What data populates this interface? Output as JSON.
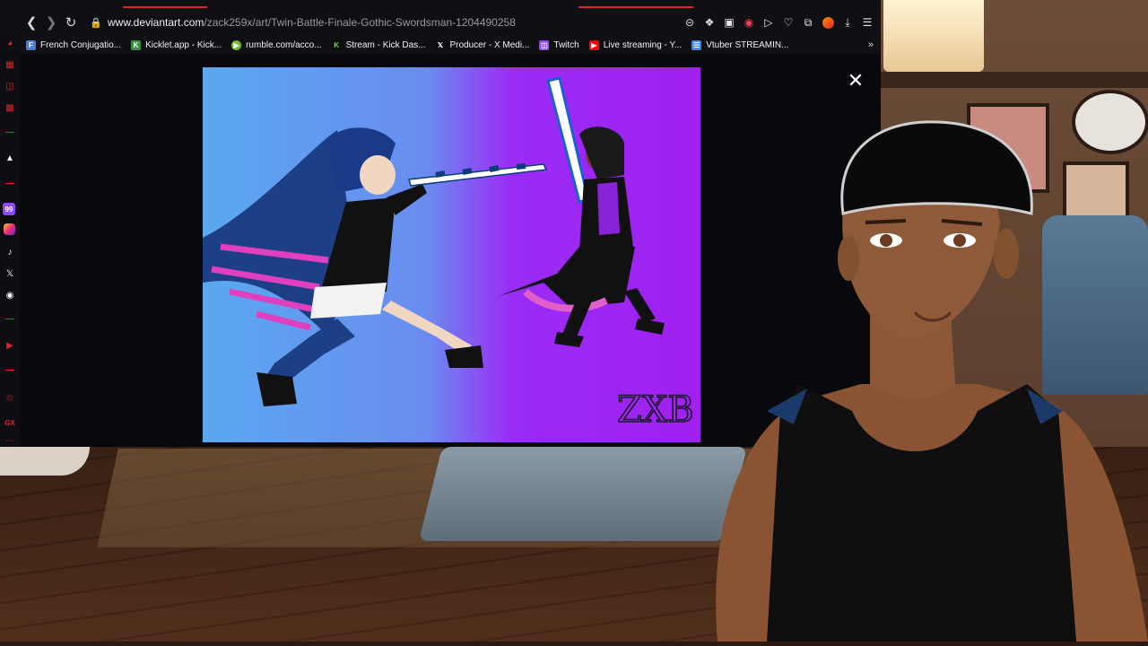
{
  "browser": {
    "url_host": "www.deviantart.com",
    "url_path": "/zack259x/art/Twin-Battle-Finale-Gothic-Swordsman-1204490258",
    "toolbar_icons": [
      "zoom-out-icon",
      "pin-icon",
      "snapshot-icon",
      "pocket-icon",
      "send-icon",
      "heart-icon",
      "extensions-icon",
      "profile-icon",
      "download-icon",
      "menu-icon"
    ],
    "bookmarks": [
      {
        "label": "French Conjugatio...",
        "icon": "French",
        "color": "#4a7bd6"
      },
      {
        "label": "Kicklet.app - Kick...",
        "icon": "Kicklet",
        "color": "#3c8f4a"
      },
      {
        "label": "rumble.com/acco...",
        "icon": "rumble",
        "color": "#6cbf2a"
      },
      {
        "label": "Stream - Kick Das...",
        "icon": "K",
        "color": "#53fc18"
      },
      {
        "label": "Producer - X Medi...",
        "icon": "X",
        "color": "#222222"
      },
      {
        "label": "Twitch",
        "icon": "twitch",
        "color": "#9146ff"
      },
      {
        "label": "Live streaming - Y...",
        "icon": "youtube",
        "color": "#ff0000"
      },
      {
        "label": "Vtuber STREAMIN...",
        "icon": "docs",
        "color": "#4285f4"
      }
    ],
    "sidebar_icons": [
      "speed-dial-icon",
      "bag-icon",
      "twitch-icon",
      "music-icon",
      "aria-icon",
      "badge-99-icon",
      "instagram-icon",
      "tiktok-icon",
      "x-icon",
      "discord-icon",
      "player-icon",
      "settings-icon",
      "gx-icon",
      "more-icon"
    ],
    "sidebar_badge": "99",
    "sidebar_gx": "GX"
  },
  "lightbox": {
    "close_icon": "close-icon",
    "signature": "ZXB"
  },
  "colors": {
    "accent": "#e0242f",
    "art_bg_left": "#5aa8f0",
    "art_bg_right": "#a020f0"
  }
}
